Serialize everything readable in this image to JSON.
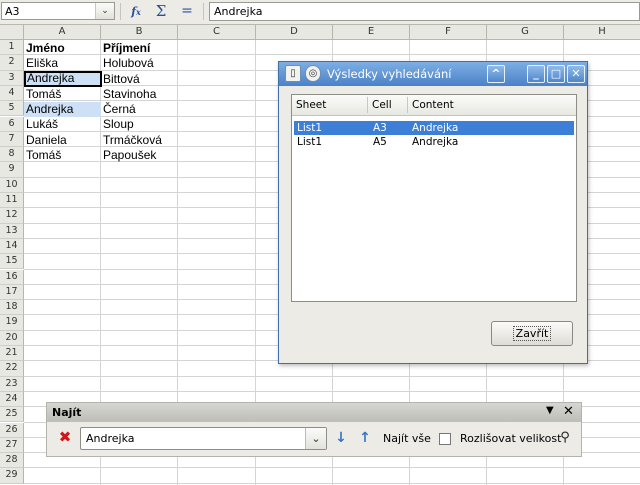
{
  "formula_bar": {
    "name_box": "A3",
    "function_wizard_icon": "function-wizard-icon",
    "sum_icon": "sum-icon",
    "formula_icon": "equals-icon",
    "value": "Andrejka"
  },
  "grid": {
    "columns": [
      "A",
      "B",
      "C",
      "D",
      "E",
      "F",
      "G",
      "H"
    ],
    "rows": [
      "1",
      "2",
      "3",
      "4",
      "5",
      "6",
      "7",
      "8",
      "9",
      "10",
      "11",
      "12",
      "13",
      "14",
      "15",
      "16",
      "17",
      "18",
      "19",
      "20",
      "21",
      "22",
      "23",
      "24",
      "25",
      "26",
      "27",
      "28",
      "29"
    ],
    "header": [
      "Jméno",
      "Příjmení"
    ],
    "data": [
      [
        "Eliška",
        "Holubová"
      ],
      [
        "Andrejka",
        "Bittová"
      ],
      [
        "Tomáš",
        "Stavinoha"
      ],
      [
        "Andrejka",
        "Černá"
      ],
      [
        "Lukáš",
        "Sloup"
      ],
      [
        "Daniela",
        "Trmáčková"
      ],
      [
        "Tomáš",
        "Papoušek"
      ]
    ],
    "active_cell": "A3",
    "highlighted_cells": [
      "A3",
      "A5"
    ],
    "highlight_color": "#cde0f5"
  },
  "results_dialog": {
    "title": "Výsledky vyhledávání",
    "columns": [
      "Sheet",
      "Cell",
      "Content"
    ],
    "rows": [
      {
        "sheet": "List1",
        "cell": "A3",
        "content": "Andrejka"
      },
      {
        "sheet": "List1",
        "cell": "A5",
        "content": "Andrejka"
      }
    ],
    "selected_row": 0,
    "close_button": "Zavřít",
    "selection_color": "#3d7fd6",
    "titlebar_color": "#5b8fd0"
  },
  "find_toolbar": {
    "title": "Najít",
    "search_value": "Andrejka",
    "find_all": "Najít vše",
    "match_case": "Rozlišovat velikost",
    "match_case_checked": false,
    "icons": [
      "clear-search-icon",
      "find-next-icon",
      "find-previous-icon",
      "find-replace-icon"
    ]
  }
}
